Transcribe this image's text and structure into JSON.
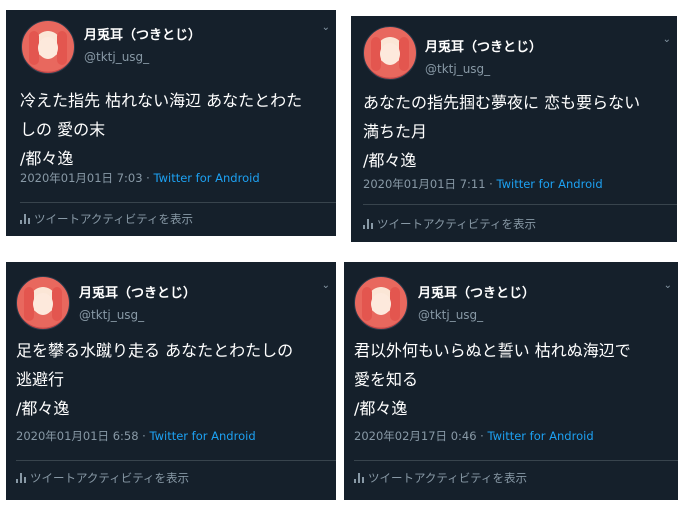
{
  "tweets": [
    {
      "name": "月兎耳（つきとじ）",
      "handle": "@tktj_usg_",
      "lines": [
        "冷えた指先 枯れない海辺 あなたとわた",
        "しの 愛の末",
        "/都々逸"
      ],
      "date": "2020年01月01日 7:03",
      "sep": "·",
      "source": "Twitter for Android",
      "activity": "ツイートアクティビティを表示"
    },
    {
      "name": "月兎耳（つきとじ）",
      "handle": "@tktj_usg_",
      "lines": [
        "あなたの指先掴む夢夜に 恋も要らない",
        "満ちた月",
        "/都々逸"
      ],
      "date": "2020年01月01日 7:11",
      "sep": "·",
      "source": "Twitter for Android",
      "activity": "ツイートアクティビティを表示"
    },
    {
      "name": "月兎耳（つきとじ）",
      "handle": "@tktj_usg_",
      "lines": [
        "足を攀る水蹴り走る あなたとわたしの",
        "逃避行",
        "/都々逸"
      ],
      "date": "2020年01月01日 6:58",
      "sep": "·",
      "source": "Twitter for Android",
      "activity": "ツイートアクティビティを表示"
    },
    {
      "name": "月兎耳（つきとじ）",
      "handle": "@tktj_usg_",
      "lines": [
        "君以外何もいらぬと誓い 枯れぬ海辺で",
        "愛を知る",
        "/都々逸"
      ],
      "date": "2020年02月17日 0:46",
      "sep": "·",
      "source": "Twitter for Android",
      "activity": "ツイートアクティビティを表示"
    }
  ],
  "colors": {
    "card_bg": "#15202b",
    "muted": "#8899a6",
    "link": "#1da1f2"
  },
  "icons": {
    "more": "chevron-down-icon",
    "activity": "bar-chart-icon"
  }
}
